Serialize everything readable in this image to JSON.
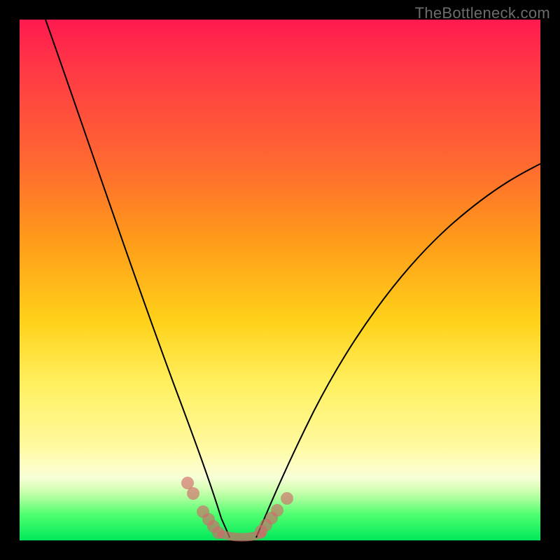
{
  "watermark": "TheBottleneck.com",
  "colors": {
    "left_dots": "#d16a6a",
    "right_dots": "#d16a6a",
    "curve": "#000000"
  },
  "chart_data": {
    "type": "line",
    "title": "",
    "xlabel": "",
    "ylabel": "",
    "xlim": [
      0,
      100
    ],
    "ylim": [
      0,
      100
    ],
    "series": [
      {
        "name": "left-curve",
        "x": [
          5,
          8,
          12,
          16,
          20,
          24,
          27,
          30,
          32,
          34,
          36,
          37,
          38,
          39
        ],
        "y": [
          100,
          90,
          76,
          62,
          48,
          34,
          24,
          16,
          11,
          7,
          4,
          2.5,
          1.2,
          0.2
        ]
      },
      {
        "name": "right-curve",
        "x": [
          45,
          47,
          50,
          54,
          58,
          63,
          68,
          74,
          80,
          88,
          96,
          100
        ],
        "y": [
          0.2,
          1.8,
          5,
          11,
          18,
          26,
          34,
          43,
          51,
          60,
          68,
          72
        ]
      }
    ],
    "markers_left": [
      {
        "x": 32,
        "y": 11
      },
      {
        "x": 33,
        "y": 9
      },
      {
        "x": 35,
        "y": 5.5
      },
      {
        "x": 36,
        "y": 4
      },
      {
        "x": 37,
        "y": 2.6
      },
      {
        "x": 38,
        "y": 1.5
      }
    ],
    "markers_right": [
      {
        "x": 46,
        "y": 1.2
      },
      {
        "x": 47,
        "y": 2.4
      },
      {
        "x": 48,
        "y": 3.8
      },
      {
        "x": 49,
        "y": 5.2
      },
      {
        "x": 51,
        "y": 7.5
      }
    ],
    "trough": {
      "x0": 38,
      "x1": 45,
      "y": 0.2
    },
    "background_gradient": [
      "#ff1a50",
      "#ff9a1a",
      "#fff060",
      "#00e85a"
    ]
  }
}
